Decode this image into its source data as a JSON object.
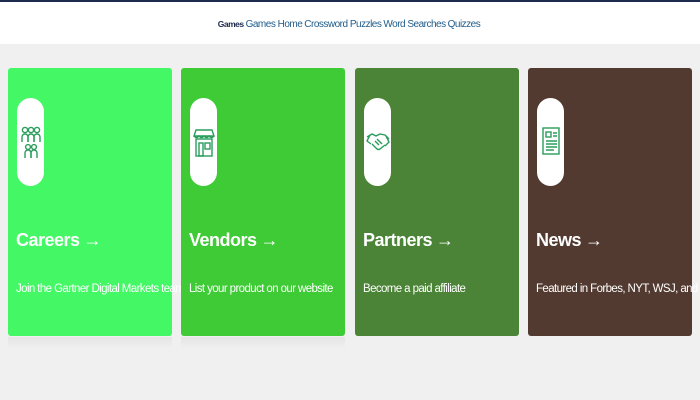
{
  "nav": {
    "brand": "Games",
    "links": [
      "Games Home",
      "Crossword Puzzles",
      "Word Searches",
      "Quizzes"
    ]
  },
  "colors": {
    "careers": "#43f765",
    "vendors": "#3fcb36",
    "partners": "#4b8436",
    "news": "#523a30",
    "icon_accent": "#2a9d5c"
  },
  "cards": [
    {
      "title": "Careers",
      "arrow": "→",
      "description": "Join the Gartner Digital Markets team in Austin.",
      "icon": "people-group-icon"
    },
    {
      "title": "Vendors",
      "arrow": "→",
      "description": "List your product on our website",
      "icon": "storefront-icon"
    },
    {
      "title": "Partners",
      "arrow": "→",
      "description": "Become a paid affiliate",
      "icon": "handshake-icon"
    },
    {
      "title": "News",
      "arrow": "→",
      "description": "Featured in Forbes, NYT, WSJ, and more",
      "icon": "newspaper-icon"
    }
  ]
}
